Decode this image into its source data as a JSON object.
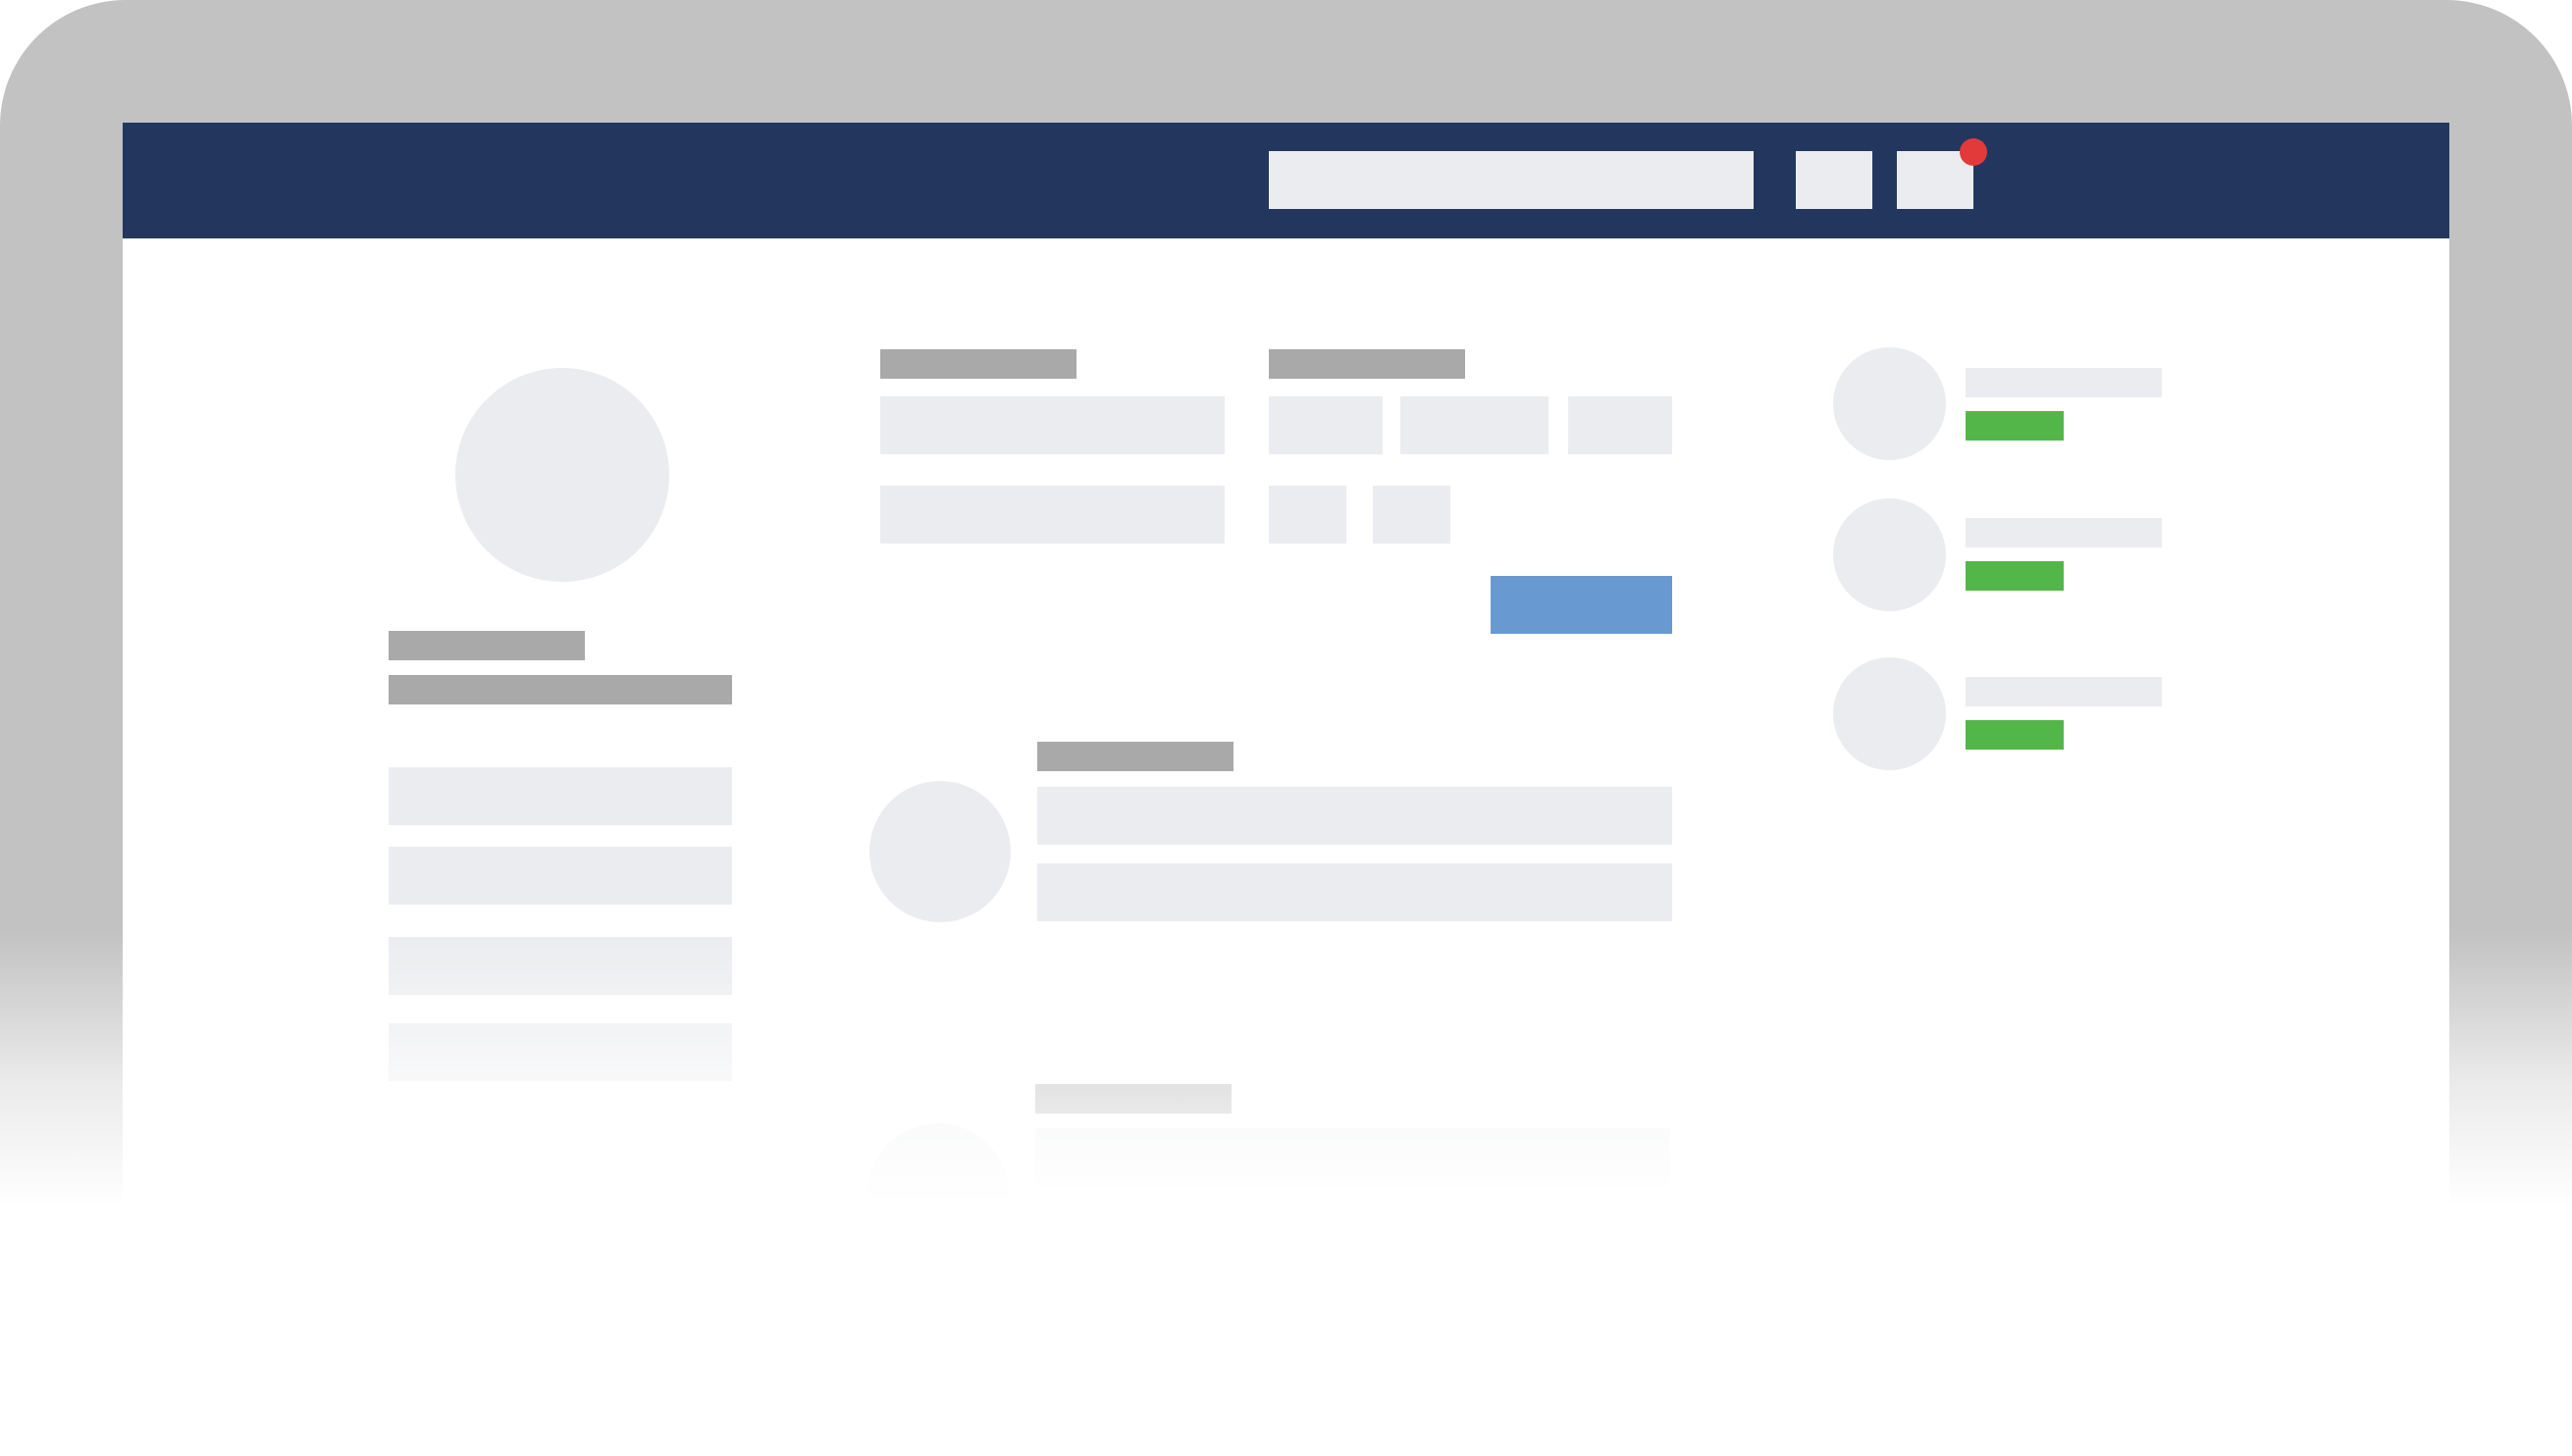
{
  "colors": {
    "bezel": "#c2c2c2",
    "topbar": "#23375e",
    "placeholder_light": "#ebecef",
    "placeholder_dark": "#a8a9a8",
    "primary_button": "#6899d1",
    "status_badge": "#52b748",
    "notification_dot": "#e23a3a"
  },
  "topbar": {
    "search": {
      "icon": "search-field",
      "placeholder": ""
    },
    "actions": [
      {
        "name": "action-button-1"
      },
      {
        "name": "notifications-button",
        "has_notification": true
      }
    ]
  },
  "profile": {
    "avatar_icon": "user-avatar",
    "name": "",
    "subtitle": "",
    "menu_items": [
      "",
      "",
      "",
      ""
    ]
  },
  "form": {
    "left_heading": "",
    "right_heading": "",
    "submit_label": ""
  },
  "feed": {
    "posts": [
      {
        "title": "",
        "lines": [
          "",
          ""
        ]
      },
      {
        "title": "",
        "lines": [
          ""
        ]
      }
    ]
  },
  "contacts": [
    {
      "name": "",
      "status": ""
    },
    {
      "name": "",
      "status": ""
    },
    {
      "name": "",
      "status": ""
    }
  ]
}
